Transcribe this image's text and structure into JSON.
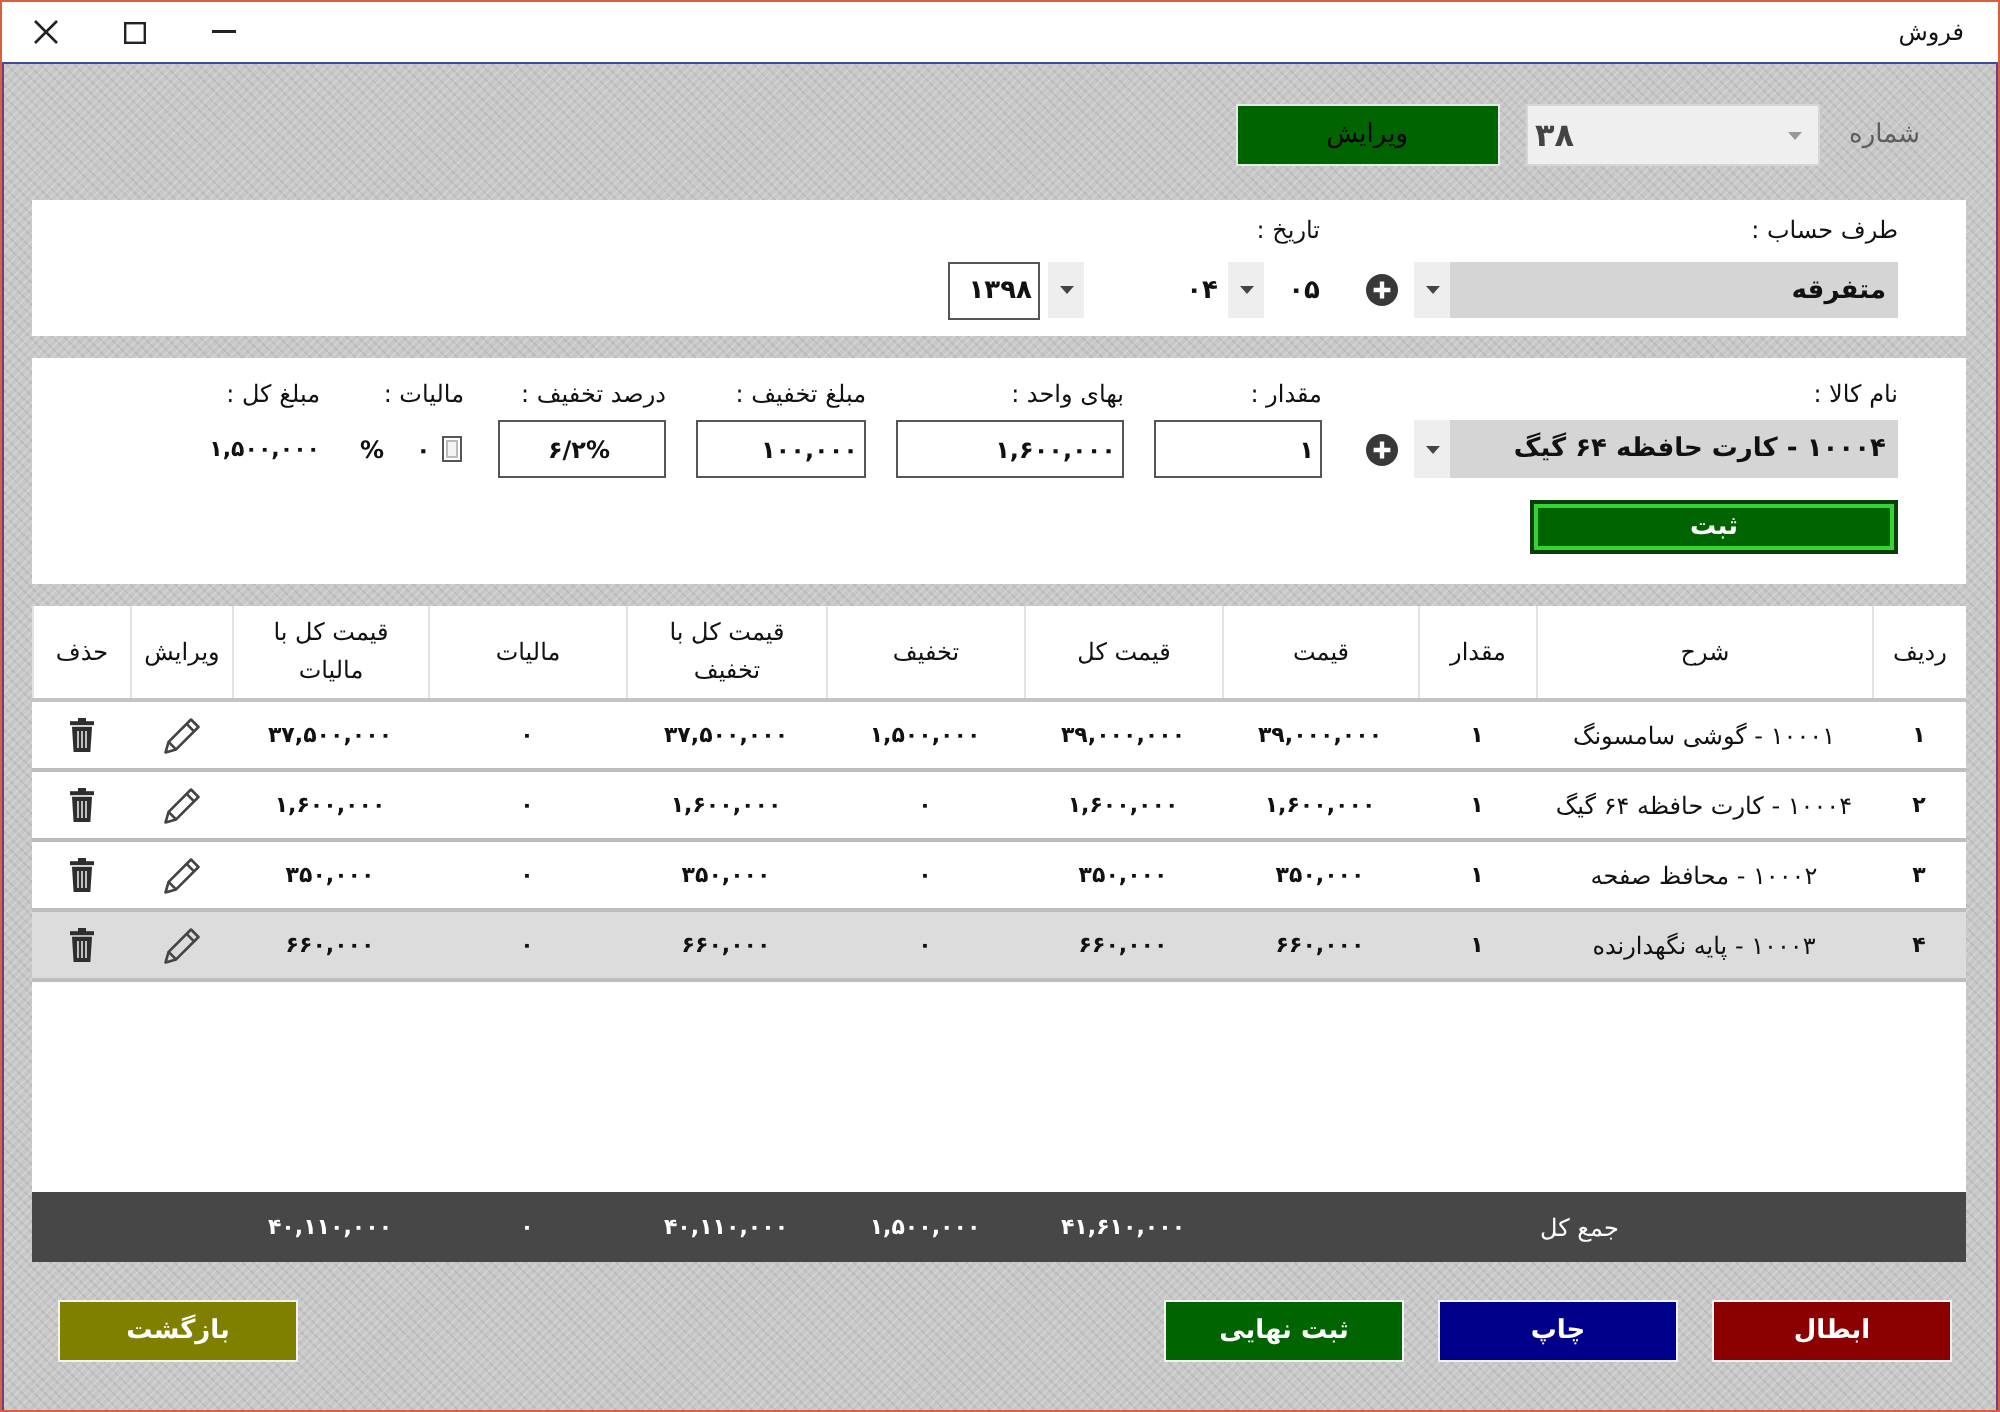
{
  "window": {
    "title": "فروش"
  },
  "header": {
    "number": {
      "label": "شماره",
      "value": "۳۸",
      "disabled": true
    },
    "edit_button": "ویرایش"
  },
  "invoice": {
    "account": {
      "label": "طرف حساب :",
      "value": "متفرقه"
    },
    "date": {
      "label": "تاریخ :",
      "day": "۰۵",
      "month": "۰۴",
      "year": "۱۳۹۸"
    }
  },
  "item_entry": {
    "product": {
      "label": "نام کالا :",
      "value": "۱۰۰۰۴ - کارت حافظه ۶۴ گیگ"
    },
    "fields": [
      {
        "kind": "input",
        "label": "مقدار :",
        "value": "۱"
      },
      {
        "kind": "input",
        "label": "بهای واحد :",
        "value": "۱,۶۰۰,۰۰۰"
      },
      {
        "kind": "input",
        "label": "مبلغ تخفیف :",
        "value": "۱۰۰,۰۰۰"
      },
      {
        "kind": "input",
        "label": "درصد تخفیف :",
        "value": "۶/۲%"
      },
      {
        "kind": "tax",
        "label": "مالیات :",
        "checked": false,
        "value": "۰",
        "unit": "%"
      },
      {
        "kind": "text",
        "label": "مبلغ کل :",
        "value": "۱,۵۰۰,۰۰۰"
      }
    ],
    "submit_button": "ثبت"
  },
  "table": {
    "columns": [
      "ردیف",
      "شرح",
      "مقدار",
      "قیمت",
      "قیمت کل",
      "تخفیف",
      "قیمت کل با تخفیف",
      "مالیات",
      "قیمت کل با مالیات",
      "ویرایش",
      "حذف"
    ],
    "rows": [
      {
        "selected": false,
        "cells": [
          "۱",
          "۱۰۰۰۱ - گوشی سامسونگ",
          "۱",
          "۳۹,۰۰۰,۰۰۰",
          "۳۹,۰۰۰,۰۰۰",
          "۱,۵۰۰,۰۰۰",
          "۳۷,۵۰۰,۰۰۰",
          "۰",
          "۳۷,۵۰۰,۰۰۰"
        ]
      },
      {
        "selected": false,
        "cells": [
          "۲",
          "۱۰۰۰۴ - کارت حافظه ۶۴ گیگ",
          "۱",
          "۱,۶۰۰,۰۰۰",
          "۱,۶۰۰,۰۰۰",
          "۰",
          "۱,۶۰۰,۰۰۰",
          "۰",
          "۱,۶۰۰,۰۰۰"
        ]
      },
      {
        "selected": false,
        "cells": [
          "۳",
          "۱۰۰۰۲ - محافظ صفحه",
          "۱",
          "۳۵۰,۰۰۰",
          "۳۵۰,۰۰۰",
          "۰",
          "۳۵۰,۰۰۰",
          "۰",
          "۳۵۰,۰۰۰"
        ]
      },
      {
        "selected": true,
        "cells": [
          "۴",
          "۱۰۰۰۳ - پایه نگهدارنده",
          "۱",
          "۶۶۰,۰۰۰",
          "۶۶۰,۰۰۰",
          "۰",
          "۶۶۰,۰۰۰",
          "۰",
          "۶۶۰,۰۰۰"
        ]
      }
    ],
    "totals": {
      "label": "جمع کل",
      "values": [
        "۴۱,۶۱۰,۰۰۰",
        "۱,۵۰۰,۰۰۰",
        "۴۰,۱۱۰,۰۰۰",
        "۰",
        "۴۰,۱۱۰,۰۰۰"
      ]
    }
  },
  "actions": [
    {
      "label": "ابطال",
      "color": "#8b0000"
    },
    {
      "label": "چاپ",
      "color": "#00008b"
    },
    {
      "label": "ثبت نهایی",
      "color": "#006400"
    }
  ],
  "back_button": "بازگشت"
}
